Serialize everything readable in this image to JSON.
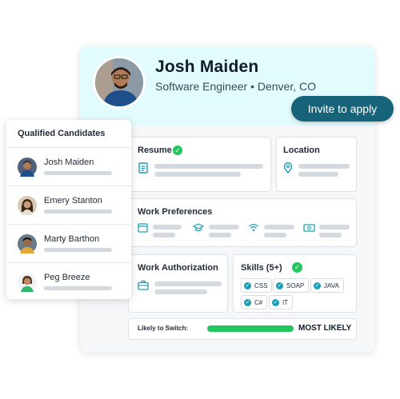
{
  "profile": {
    "name": "Josh Maiden",
    "subtitle": "Software Engineer • Denver, CO"
  },
  "invite_button": {
    "label": "Invite to apply"
  },
  "sections": {
    "resume": {
      "title": "Resume",
      "icon": "document-icon",
      "verified": true
    },
    "location": {
      "title": "Location",
      "icon": "map-pin-icon"
    },
    "work_preferences": {
      "title": "Work Preferences",
      "icons": [
        "calendar-icon",
        "graduation-cap-icon",
        "wifi-icon",
        "money-icon"
      ]
    },
    "work_authorization": {
      "title": "Work Authorization",
      "icon": "briefcase-icon"
    },
    "skills": {
      "title": "Skills (5+)",
      "verified": true,
      "items": [
        "CSS",
        "SOAP",
        "JAVA",
        "C#",
        "IT"
      ]
    },
    "likely_to_switch": {
      "label": "Likely to Switch:",
      "value": "MOST LIKELY",
      "level": 1.0
    }
  },
  "candidates": {
    "title": "Qualified Candidates",
    "items": [
      {
        "name": "Josh Maiden"
      },
      {
        "name": "Emery Stanton"
      },
      {
        "name": "Marty Barthon"
      },
      {
        "name": "Peg Breeze"
      }
    ]
  },
  "colors": {
    "header_bg": "#e2fbfd",
    "accent_teal": "#1b9fb8",
    "button_bg": "#17637a",
    "success_green": "#22c55e"
  }
}
